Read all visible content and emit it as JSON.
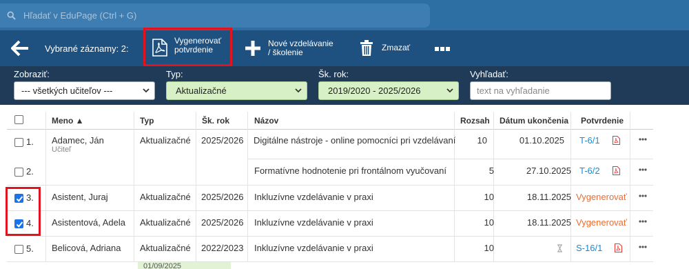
{
  "search": {
    "placeholder": "Hľadať v EduPage (Ctrl + G)"
  },
  "actionbar": {
    "selected_label": "Vybrané záznamy: 2:",
    "generate_line1": "Vygenerovať",
    "generate_line2": "potvrdenie",
    "new_line1": "Nové vzdelávanie",
    "new_line2": "/ školenie",
    "delete_label": "Zmazať"
  },
  "filters": {
    "show_label": "Zobraziť:",
    "show_value": "--- všetkých učiteľov ---",
    "type_label": "Typ:",
    "type_value": "Aktualizačné",
    "year_label": "Šk. rok:",
    "year_value": "2019/2020 - 2025/2026",
    "search_label": "Vyhľadať:",
    "search_placeholder": "text na vyhľadanie"
  },
  "table": {
    "headers": {
      "name": "Meno ▲",
      "type": "Typ",
      "year": "Šk. rok",
      "title": "Názov",
      "range": "Rozsah",
      "end_date": "Dátum ukončenia",
      "certificate": "Potvrdenie"
    },
    "rows": [
      {
        "num": "1.",
        "checked": false,
        "name": "Adamec, Ján",
        "role": "Učiteľ",
        "type": "Aktualizačné",
        "year": "2025/2026",
        "title": "Digitálne nástroje - online pomocníci pri vzdelávaní",
        "range": "10",
        "end_date": "01.10.2025",
        "certificate": "T-6/1"
      },
      {
        "num": "2.",
        "checked": false,
        "title": "Formatívne hodnotenie pri frontálnom vyučovaní",
        "range": "5",
        "end_date": "27.10.2025",
        "certificate": "T-6/2"
      },
      {
        "num": "3.",
        "checked": true,
        "name": "Asistent, Juraj",
        "type": "Aktualizačné",
        "year": "2025/2026",
        "title": "Inkluzívne vzdelávanie v praxi",
        "range": "10",
        "end_date": "18.11.2025",
        "certificate": "Vygenerovať"
      },
      {
        "num": "4.",
        "checked": true,
        "name": "Asistentová, Adela",
        "type": "Aktualizačné",
        "year": "2025/2026",
        "title": "Inkluzívne vzdelávanie v praxi",
        "range": "10",
        "end_date": "18.11.2025",
        "certificate": "Vygenerovať"
      },
      {
        "num": "5.",
        "checked": false,
        "name": "Belicová, Adriana",
        "type": "Aktualizačné",
        "year": "2022/2023",
        "title": "Inkluzívne vzdelávanie v praxi",
        "range": "10",
        "end_date": "",
        "certificate": "S-16/1"
      }
    ],
    "partial_row_text": "01/09/2025"
  },
  "colors": {
    "top": "#2d6ea3",
    "action": "#1e5180",
    "filter": "#1f3b57",
    "highlight": "#e0141e",
    "link": "#1a8ad4",
    "generate": "#f06a2c"
  }
}
